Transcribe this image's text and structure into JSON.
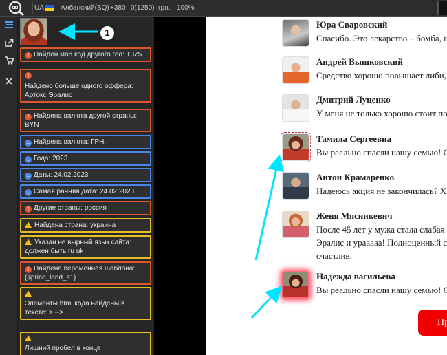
{
  "topbar": {
    "country_code": "UA",
    "language": "Албанский(SQ)",
    "phone_code": "+380",
    "counter": "0(1250)",
    "currency": "грн.",
    "zoom": "100%"
  },
  "rail": {
    "icons": [
      "menu-icon",
      "export-icon",
      "cart-icon",
      "close-icon"
    ]
  },
  "checks": [
    {
      "kind": "error",
      "color": "red",
      "text": "Найден моб код другого гео: +375"
    },
    {
      "kind": "error",
      "color": "red",
      "text": "Найдено больше одного оффера: Артокс Эралис"
    },
    {
      "kind": "error",
      "color": "red",
      "text": "Найдена валюта другой страны: BYN"
    },
    {
      "kind": "info",
      "color": "blue",
      "text": "Найдена валюта: ГРН."
    },
    {
      "kind": "info",
      "color": "blue",
      "text": "Года: 2023"
    },
    {
      "kind": "info",
      "color": "blue",
      "text": "Даты: 24.02.2023"
    },
    {
      "kind": "info",
      "color": "blue",
      "text": "Самая ранняя дата: 24.02.2023"
    },
    {
      "kind": "error",
      "color": "red",
      "text": "Другие страны: россия"
    },
    {
      "kind": "warning",
      "color": "yellow",
      "text": "Найдена страна: украина"
    },
    {
      "kind": "warning",
      "color": "yellow",
      "text": "Указан не вырный язык сайта: должен быть ru uk"
    },
    {
      "kind": "error",
      "color": "red",
      "text": "Найдена переменная шаблона: {$price_land_s1}"
    },
    {
      "kind": "warning",
      "color": "yellow",
      "text": "Элементы html кода найдены в тексте: > -->"
    },
    {
      "kind": "warning",
      "color": "yellow",
      "text": "Лишний пробел в конце"
    }
  ],
  "annotation": {
    "badge_number": "1",
    "arrow_color": "#00e5ff"
  },
  "comments": [
    {
      "name": "Юра Сваровский",
      "text": "Спасибо. Это лекарство – бомба, н"
    },
    {
      "name": "Андрей Вышковский",
      "text": "Средство хорошо повышает либи,"
    },
    {
      "name": "Дмитрий Луценко",
      "text": "У меня не только хорошо стоит по"
    },
    {
      "name": "Тамила Сергеевна",
      "text": "Вы реально спасли нашу семью! С"
    },
    {
      "name": "Антон Крамаренко",
      "text": "Надеюсь акция не закончилась? Х"
    },
    {
      "name": "Женя Мясникевич",
      "text": "После 45 лет у мужа стала слабая\nЭралис и урааааа! Полноценный се\nсчастлив."
    },
    {
      "name": "Надежда васильева",
      "text": "Вы реально спасли нашу семью! С"
    }
  ],
  "order_button": {
    "label": "Пр"
  }
}
